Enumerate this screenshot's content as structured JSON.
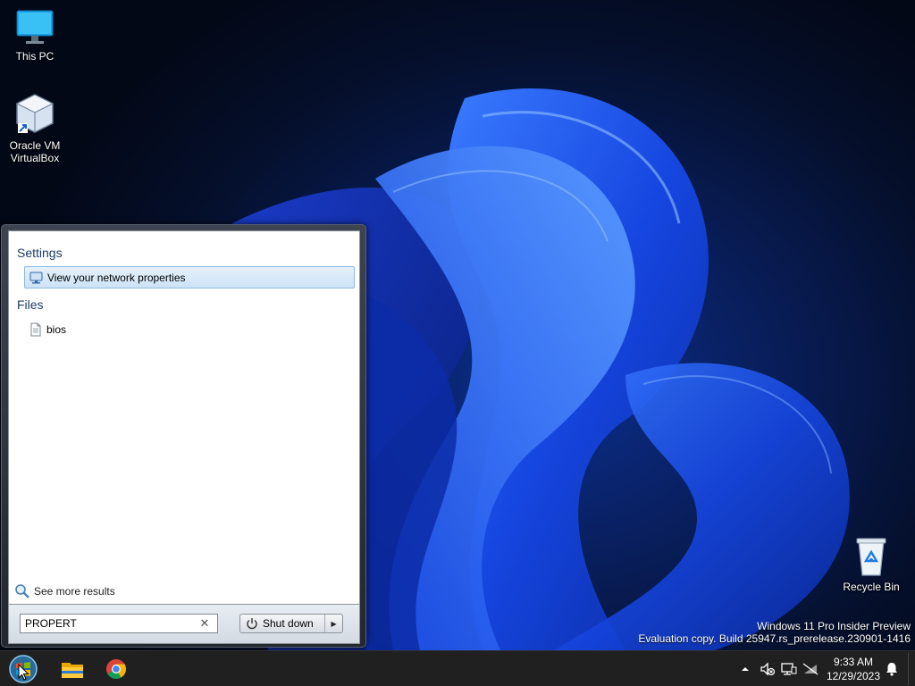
{
  "desktop": {
    "icons": [
      {
        "label": "This PC",
        "icon": "monitor-icon"
      },
      {
        "label": "Oracle VM VirtualBox",
        "icon": "virtualbox-icon"
      },
      {
        "label": "Recycle Bin",
        "icon": "recycle-bin-icon"
      }
    ],
    "watermark": {
      "line1": "Windows 11 Pro Insider Preview",
      "line2": "Evaluation copy. Build 25947.rs_prerelease.230901-1416"
    }
  },
  "start_menu": {
    "groups": [
      {
        "title": "Settings",
        "items": [
          {
            "label": "View your network properties",
            "icon": "network-icon",
            "selected": true
          }
        ]
      },
      {
        "title": "Files",
        "items": [
          {
            "label": "bios",
            "icon": "document-icon",
            "selected": false
          }
        ]
      }
    ],
    "see_more": "See more results",
    "search": {
      "value": "PROPERT"
    },
    "shutdown_label": "Shut down"
  },
  "taskbar": {
    "apps": [
      "start-orb-icon",
      "file-explorer-icon",
      "chrome-icon"
    ],
    "tray_icons": [
      "show-hidden-icons-chevron",
      "speaker-muted-icon",
      "network-icon",
      "battery-icon",
      "notification-bell-icon"
    ],
    "time": "9:33 AM",
    "date": "12/29/2023"
  },
  "colors": {
    "accent_blue": "#1f5cff",
    "selection": "#cce3f6",
    "taskbar": "#202020"
  }
}
